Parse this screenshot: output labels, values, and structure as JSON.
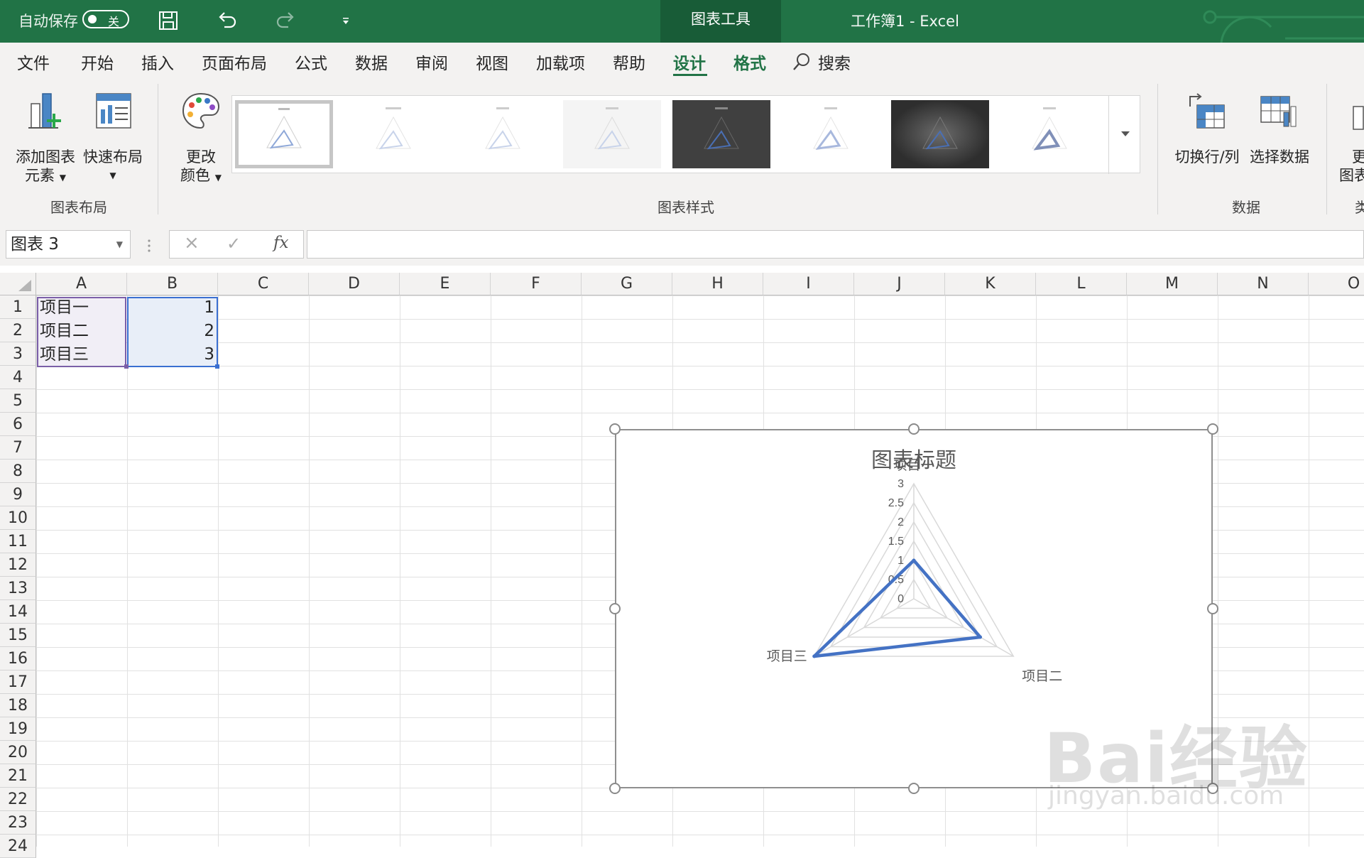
{
  "titlebar": {
    "autosave_label": "自动保存",
    "autosave_state": "关",
    "chart_tools_label": "图表工具",
    "workbook_title": "工作簿1  -  Excel"
  },
  "tabs": [
    {
      "label": "文件",
      "active": false
    },
    {
      "label": "开始",
      "active": false
    },
    {
      "label": "插入",
      "active": false
    },
    {
      "label": "页面布局",
      "active": false
    },
    {
      "label": "公式",
      "active": false
    },
    {
      "label": "数据",
      "active": false
    },
    {
      "label": "审阅",
      "active": false
    },
    {
      "label": "视图",
      "active": false
    },
    {
      "label": "加载项",
      "active": false
    },
    {
      "label": "帮助",
      "active": false
    },
    {
      "label": "设计",
      "active": true
    },
    {
      "label": "格式",
      "active": false
    }
  ],
  "search_label": "搜索",
  "ribbon": {
    "add_element_line1": "添加图表",
    "add_element_line2": "元素",
    "quick_layout": "快速布局",
    "change_colors_line1": "更改",
    "change_colors_line2": "颜色",
    "switch_row_col": "切换行/列",
    "select_data": "选择数据",
    "change_type_line1": "更",
    "change_type_line2": "图表",
    "groups": {
      "chart_layouts": "图表布局",
      "chart_styles": "图表样式",
      "data": "数据",
      "type": "类"
    }
  },
  "formula_bar": {
    "name_box": "图表 3",
    "cancel_icon": "×",
    "enter_icon": "✓",
    "fx": "fx",
    "value": ""
  },
  "columns": [
    "A",
    "B",
    "C",
    "D",
    "E",
    "F",
    "G",
    "H",
    "I",
    "J",
    "K",
    "L",
    "M",
    "N",
    "O"
  ],
  "rows": [
    "1",
    "2",
    "3",
    "4",
    "5",
    "6",
    "7",
    "8",
    "9",
    "10",
    "11",
    "12",
    "13",
    "14",
    "15",
    "16",
    "17",
    "18",
    "19",
    "20",
    "21",
    "22",
    "23",
    "24"
  ],
  "cells": [
    {
      "ref": "A1",
      "value": "项目一"
    },
    {
      "ref": "B1",
      "value": "1"
    },
    {
      "ref": "A2",
      "value": "项目二"
    },
    {
      "ref": "B2",
      "value": "2"
    },
    {
      "ref": "A3",
      "value": "项目三"
    },
    {
      "ref": "B3",
      "value": "3"
    }
  ],
  "watermark": {
    "text": "Bai经验",
    "subtext": "jingyan.baidu.com"
  },
  "colors": {
    "excel_green": "#217346",
    "series": "#4472c4",
    "grid": "#d9d9d9"
  },
  "chart_data": {
    "type": "radar",
    "title": "图表标题",
    "categories": [
      "项目一",
      "项目二",
      "项目三"
    ],
    "series": [
      {
        "values": [
          1,
          2,
          3
        ]
      }
    ],
    "ylim": [
      0,
      3
    ],
    "ticks": [
      "0",
      "0.5",
      "1",
      "1.5",
      "2",
      "2.5",
      "3"
    ],
    "tick_values": [
      0,
      0.5,
      1,
      1.5,
      2,
      2.5,
      3
    ],
    "legend": "none"
  }
}
